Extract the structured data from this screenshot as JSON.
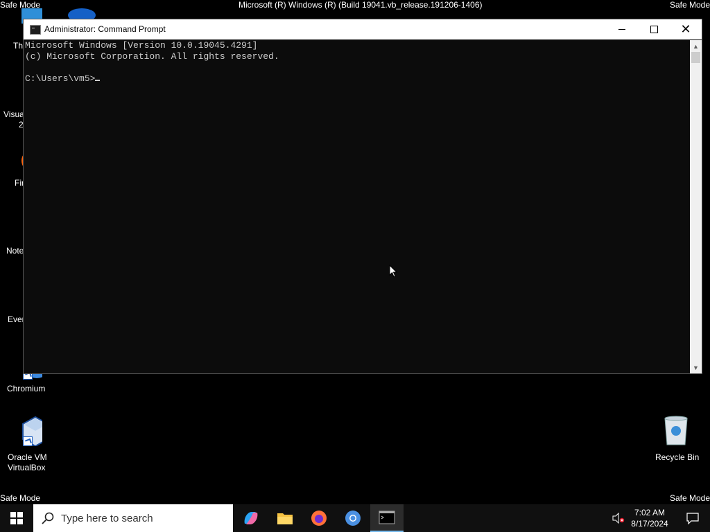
{
  "safe_mode_top_left": "Safe Mode",
  "safe_mode_top_right": "Safe Mode",
  "safe_mode_bottom_left": "Safe Mode",
  "safe_mode_bottom_right": "Safe Mode",
  "build_string": "Microsoft (R) Windows (R) (Build 19041.vb_release.191206-1406)",
  "desktop_icons": {
    "partial1": "Th",
    "partial2_line1": "Visua",
    "partial2_line2": "2",
    "partial3": "Fir",
    "partial4": "Note",
    "partial5": "Ever",
    "chromium": "Chromium",
    "virtualbox_line1": "Oracle VM",
    "virtualbox_line2": "VirtualBox",
    "recycle_bin": "Recycle Bin"
  },
  "cmd_window": {
    "title": "Administrator: Command Prompt",
    "lines": [
      "Microsoft Windows [Version 10.0.19045.4291]",
      "(c) Microsoft Corporation. All rights reserved.",
      "",
      "C:\\Users\\vm5>"
    ]
  },
  "taskbar": {
    "search_placeholder": "Type here to search",
    "time": "7:02 AM",
    "date": "8/17/2024"
  },
  "colors": {
    "console_bg": "#0c0c0c",
    "console_text": "#cccccc",
    "taskbar_bg": "#101010",
    "accent": "#76b9ed"
  }
}
